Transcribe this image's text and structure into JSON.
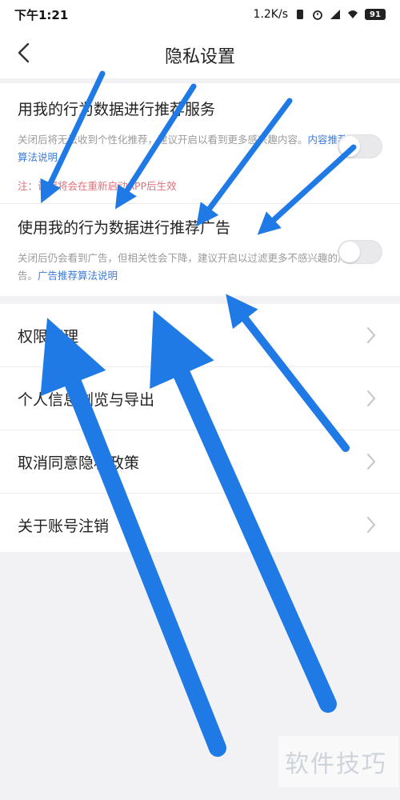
{
  "status_bar": {
    "time": "下午1:21",
    "net_speed": "1.2K/s",
    "battery": "91",
    "icons": [
      "wifi-vibrate-icon",
      "alarm-icon",
      "signal-icon",
      "wifi-icon",
      "battery-icon"
    ]
  },
  "header": {
    "title": "隐私设置",
    "back_icon": "chevron-left-icon"
  },
  "settings": [
    {
      "title": "用我的行为数据进行推荐服务",
      "desc": "关闭后将无法收到个性化推荐，建议开启以看到更多感兴趣内容。",
      "link": "内容推荐算法说明",
      "note": "注：设置将会在重新启动APP后生效",
      "enabled": false
    },
    {
      "title": "使用我的行为数据进行推荐广告",
      "desc": "关闭后仍会看到广告，但相关性会下降，建议开启以过滤更多不感兴趣的广告。",
      "link": "广告推荐算法说明",
      "enabled": false
    }
  ],
  "menu": [
    {
      "label": "权限管理"
    },
    {
      "label": "个人信息浏览与导出"
    },
    {
      "label": "取消同意隐私政策"
    },
    {
      "label": "关于账号注销"
    }
  ],
  "watermark": "软件技巧",
  "colors": {
    "arrow": "#1f7ae6",
    "link": "#3d7bd9",
    "note": "#e0707a",
    "background": "#f2f2f4"
  }
}
